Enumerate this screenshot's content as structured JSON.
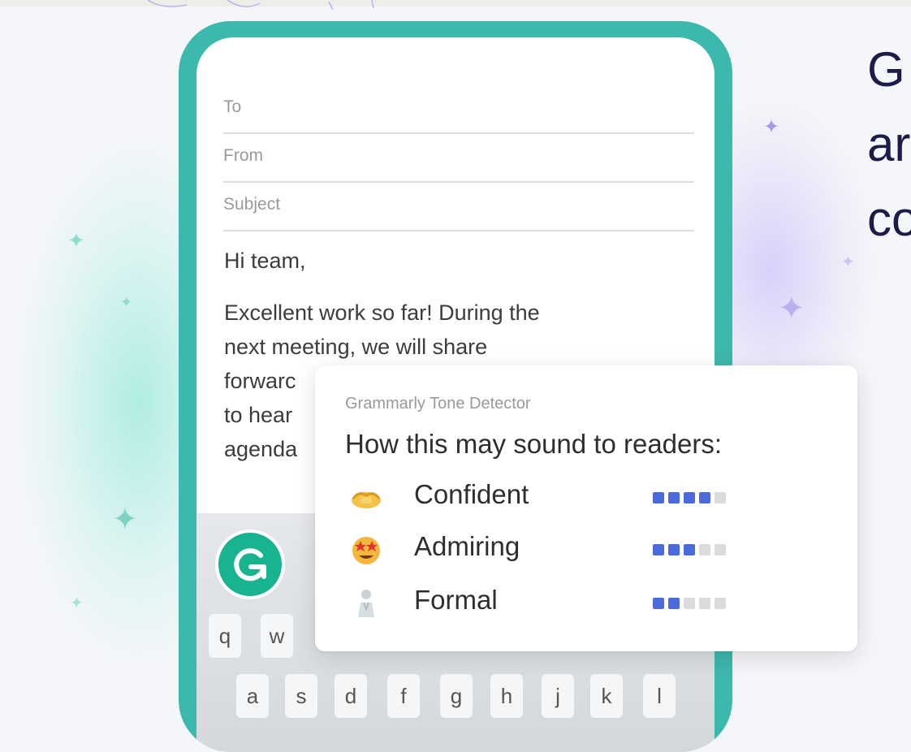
{
  "email": {
    "to_label": "To",
    "from_label": "From",
    "subject_label": "Subject",
    "greeting": "Hi team,",
    "body_lines": [
      "Excellent work so far! During the",
      "next meeting, we will share",
      "forwarc",
      "to hear",
      "agenda"
    ]
  },
  "tone_detector": {
    "caption": "Grammarly Tone Detector",
    "title": "How this may sound to readers:",
    "tones": [
      {
        "label": "Confident",
        "icon": "handshake-icon",
        "level": 4,
        "max": 5
      },
      {
        "label": "Admiring",
        "icon": "star-struck-face-icon",
        "level": 3,
        "max": 5
      },
      {
        "label": "Formal",
        "icon": "formal-figure-icon",
        "level": 2,
        "max": 5
      }
    ]
  },
  "keyboard": {
    "row1": [
      "q",
      "w"
    ],
    "row2": [
      "a",
      "s",
      "d",
      "f",
      "g",
      "h",
      "j",
      "k",
      "l"
    ]
  },
  "headline_lines": [
    "G",
    "ar",
    "co"
  ],
  "colors": {
    "phone_frame": "#3db8ac",
    "grammarly_green": "#18b38f",
    "meter_active": "#4c6bdb",
    "headline": "#1e1b4b"
  }
}
